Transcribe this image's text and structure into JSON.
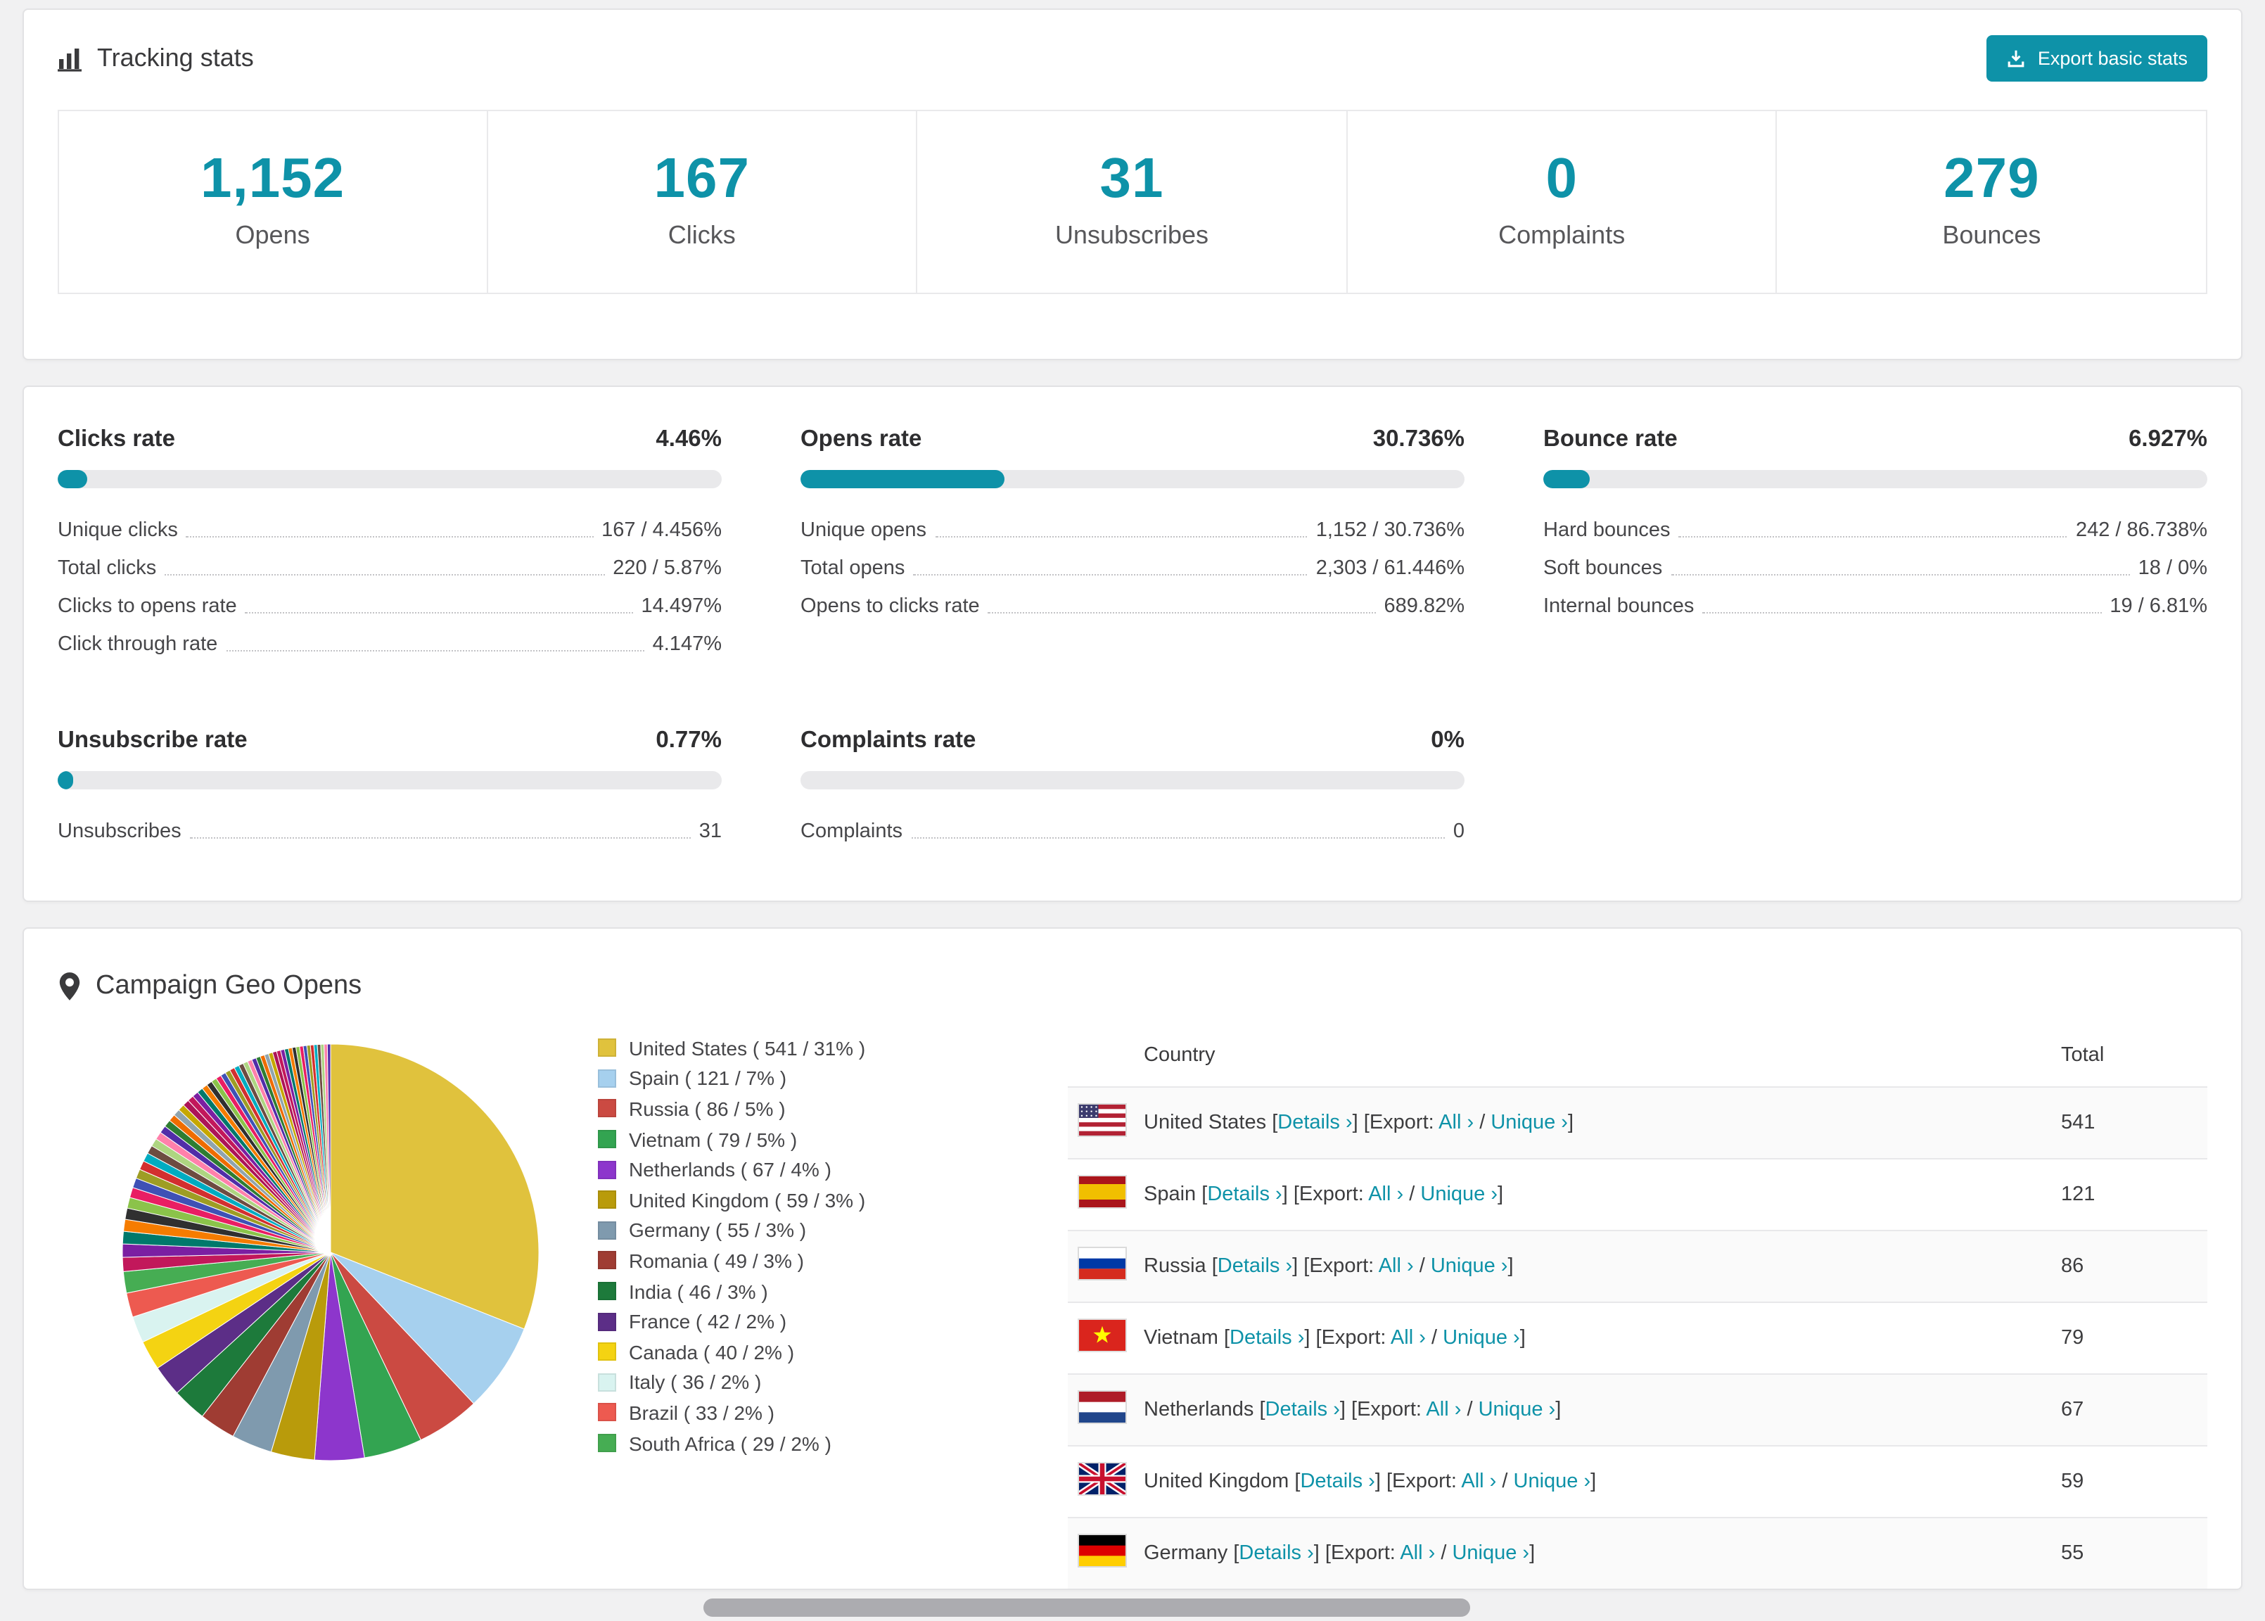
{
  "colors": {
    "accent": "#0e92a8",
    "page_bg": "#f1f1f2",
    "bar_track": "#e9e9eb"
  },
  "tracking": {
    "title": "Tracking stats",
    "export_button": "Export basic stats",
    "stats": [
      {
        "value": "1,152",
        "label": "Opens"
      },
      {
        "value": "167",
        "label": "Clicks"
      },
      {
        "value": "31",
        "label": "Unsubscribes"
      },
      {
        "value": "0",
        "label": "Complaints"
      },
      {
        "value": "279",
        "label": "Bounces"
      }
    ]
  },
  "rates": [
    {
      "title": "Clicks rate",
      "value": "4.46%",
      "percent": 4.46,
      "rows": [
        {
          "label": "Unique clicks",
          "value": "167 / 4.456%"
        },
        {
          "label": "Total clicks",
          "value": "220 / 5.87%"
        },
        {
          "label": "Clicks to opens rate",
          "value": "14.497%"
        },
        {
          "label": "Click through rate",
          "value": "4.147%"
        }
      ]
    },
    {
      "title": "Opens rate",
      "value": "30.736%",
      "percent": 30.736,
      "rows": [
        {
          "label": "Unique opens",
          "value": "1,152 / 30.736%"
        },
        {
          "label": "Total opens",
          "value": "2,303 / 61.446%"
        },
        {
          "label": "Opens to clicks rate",
          "value": "689.82%"
        }
      ]
    },
    {
      "title": "Bounce rate",
      "value": "6.927%",
      "percent": 6.927,
      "rows": [
        {
          "label": "Hard bounces",
          "value": "242 / 86.738%"
        },
        {
          "label": "Soft bounces",
          "value": "18 / 0%"
        },
        {
          "label": "Internal bounces",
          "value": "19 / 6.81%"
        }
      ]
    },
    {
      "title": "Unsubscribe rate",
      "value": "0.77%",
      "percent": 0.77,
      "rows": [
        {
          "label": "Unsubscribes",
          "value": "31"
        }
      ]
    },
    {
      "title": "Complaints rate",
      "value": "0%",
      "percent": 0,
      "rows": [
        {
          "label": "Complaints",
          "value": "0"
        }
      ]
    }
  ],
  "chart_data": {
    "type": "pie",
    "title": "Campaign Geo Opens",
    "categories": [
      "United States",
      "Spain",
      "Russia",
      "Vietnam",
      "Netherlands",
      "United Kingdom",
      "Germany",
      "Romania",
      "India",
      "France",
      "Canada",
      "Italy",
      "Brazil",
      "South Africa"
    ],
    "values": [
      541,
      121,
      86,
      79,
      67,
      59,
      55,
      49,
      46,
      42,
      40,
      36,
      33,
      29
    ],
    "percents": [
      31,
      7,
      5,
      5,
      4,
      3,
      3,
      3,
      3,
      2,
      2,
      2,
      2,
      2
    ],
    "colors": [
      "#e0c23d",
      "#a6d0ee",
      "#cb4a42",
      "#33a451",
      "#8d36cc",
      "#b99b0b",
      "#7f9aae",
      "#9f3c33",
      "#1d7a3b",
      "#5c2e87",
      "#f4d312",
      "#d9f3f0",
      "#ed5a50",
      "#46ad53"
    ],
    "others_total_estimate": 462,
    "others_slice_count": 55,
    "others_colors": [
      "#c2185b",
      "#7b1fa2",
      "#00796b",
      "#f57c00",
      "#303030",
      "#8bc34a",
      "#e91e63",
      "#3f51b5",
      "#9e9d24",
      "#d32f2f",
      "#00acc1",
      "#6d4c41",
      "#aed581",
      "#ff80ab",
      "#512da8",
      "#2e7d32",
      "#ef6c00",
      "#90a4ae",
      "#c6a700",
      "#ad1457"
    ],
    "legend_position": "right",
    "start_angle_deg": -90,
    "direction": "clockwise"
  },
  "geo": {
    "title": "Campaign Geo Opens",
    "table": {
      "columns": {
        "country": "Country",
        "total": "Total"
      },
      "details_label": "Details",
      "export_prefix": "Export:",
      "all_label": "All",
      "unique_label": "Unique",
      "rows": [
        {
          "country": "United States",
          "flag": "us",
          "total": 541
        },
        {
          "country": "Spain",
          "flag": "es",
          "total": 121
        },
        {
          "country": "Russia",
          "flag": "ru",
          "total": 86
        },
        {
          "country": "Vietnam",
          "flag": "vn",
          "total": 79
        },
        {
          "country": "Netherlands",
          "flag": "nl",
          "total": 67
        },
        {
          "country": "United Kingdom",
          "flag": "gb",
          "total": 59
        },
        {
          "country": "Germany",
          "flag": "de",
          "total": 55
        }
      ]
    }
  }
}
